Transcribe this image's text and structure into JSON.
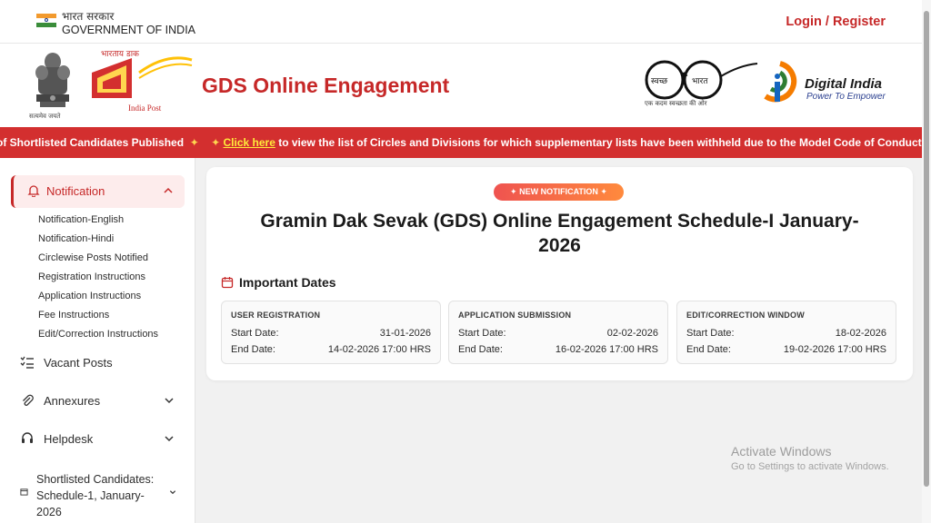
{
  "govbar": {
    "hindi": "भारत सरकार",
    "english": "GOVERNMENT OF INDIA",
    "login": "Login / Register"
  },
  "header": {
    "emblem_caption": "सत्यमेव जयते",
    "postal_hindi": "भारतीय डाक",
    "postal_english": "India Post",
    "title": "GDS Online Engagement",
    "swachh_left": "स्वच्छ",
    "swachh_right": "भारत",
    "swachh_caption": "एक कदम स्वच्छता की ओर",
    "digital_india": "Digital India",
    "digital_india_tagline": "Power To Empower"
  },
  "ticker": {
    "lead": "of Shortlisted Candidates Published",
    "link": "Click here",
    "rest": "to view the list of Circles and Divisions for which supplementary lists have been withheld due to the Model Code of Conduct"
  },
  "sidebar": {
    "active": "Notification",
    "sub_items": [
      "Notification-English",
      "Notification-Hindi",
      "Circlewise Posts Notified",
      "Registration Instructions",
      "Application Instructions",
      "Fee Instructions",
      "Edit/Correction Instructions"
    ],
    "vacant": "Vacant Posts",
    "annexures": "Annexures",
    "helpdesk": "Helpdesk",
    "shortlisted": "Shortlisted Candidates: Schedule-1, January-2026"
  },
  "main": {
    "badge": "NEW NOTIFICATION",
    "title": "Gramin Dak Sevak (GDS) Online Engagement Schedule-I January-2026",
    "important_dates": "Important Dates",
    "start_label": "Start Date:",
    "end_label": "End Date:",
    "boxes": [
      {
        "heading": "USER REGISTRATION",
        "start": "31-01-2026",
        "end": "14-02-2026 17:00 HRS"
      },
      {
        "heading": "APPLICATION SUBMISSION",
        "start": "02-02-2026",
        "end": "16-02-2026 17:00 HRS"
      },
      {
        "heading": "EDIT/CORRECTION WINDOW",
        "start": "18-02-2026",
        "end": "19-02-2026 17:00 HRS"
      }
    ]
  },
  "watermark": {
    "title": "Activate Windows",
    "subtitle": "Go to Settings to activate Windows."
  },
  "colors": {
    "brand_red": "#c62828",
    "ticker_red": "#d32f2f",
    "link_yellow": "#ffeb3b"
  }
}
